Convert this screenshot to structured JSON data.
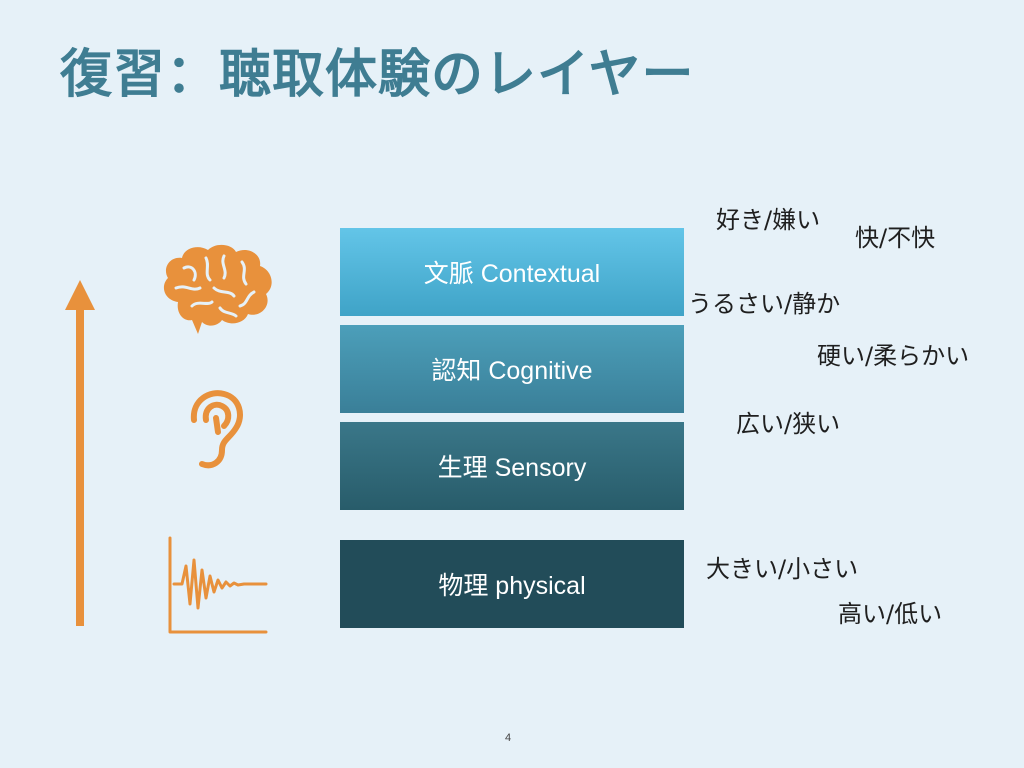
{
  "title": "復習：聴取体験のレイヤー",
  "layers": [
    {
      "label": "文脈 Contextual"
    },
    {
      "label": "認知 Cognitive"
    },
    {
      "label": "生理 Sensory"
    },
    {
      "label": "物理 physical"
    }
  ],
  "terms": {
    "like": "好き/嫌い",
    "pleasant": "快/不快",
    "loud": "うるさい/静か",
    "hard": "硬い/柔らかい",
    "wide": "広い/狭い",
    "big": "大きい/小さい",
    "high": "高い/低い"
  },
  "icons": {
    "brain": "brain-icon",
    "ear": "ear-icon",
    "waveform": "waveform-icon",
    "arrow": "up-arrow-icon"
  },
  "colors": {
    "accent": "#e8913c",
    "title": "#3f7d92",
    "background": "#e6f1f8"
  },
  "page_number": "4"
}
